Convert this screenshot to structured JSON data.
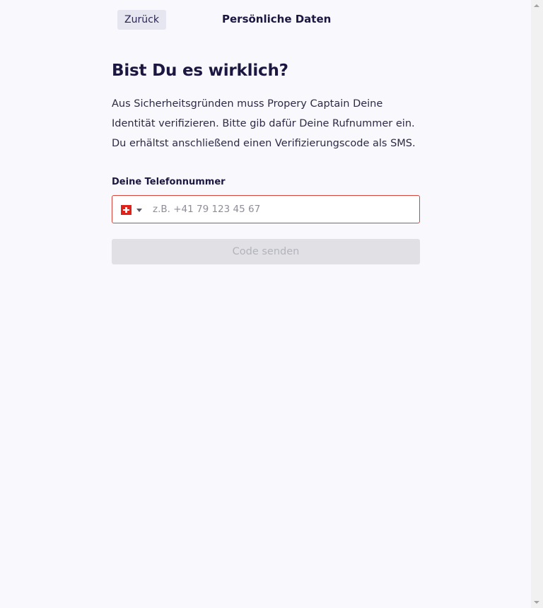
{
  "header": {
    "back_label": "Zurück",
    "title": "Persönliche Daten"
  },
  "main": {
    "heading": "Bist Du es wirklich?",
    "intro_lines": [
      "Aus Sicherheitsgründen muss Propery Captain Deine",
      "Identität verifizieren. Bitte gib dafür Deine Rufnummer ein.",
      "Du erhältst anschließend einen Verifizierungscode als SMS."
    ],
    "phone": {
      "label": "Deine Telefonnummer",
      "country_flag": "swiss-flag-icon",
      "value": "",
      "placeholder": "z.B. +41 79 123 45 67",
      "error_border_color": "#d9433a"
    },
    "submit_label": "Code senden"
  },
  "colors": {
    "background": "#f8f8fd",
    "text": "#1c1740",
    "disabled_button": "#e0e0e5"
  }
}
